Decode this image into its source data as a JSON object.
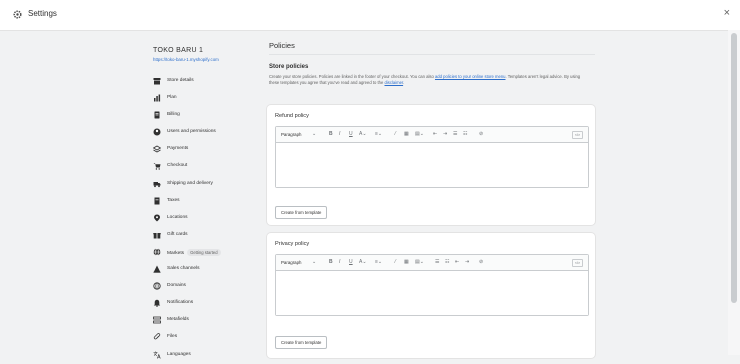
{
  "window": {
    "title": "Settings",
    "close_icon": "close-icon",
    "gear_icon": "gear-icon"
  },
  "sidebar": {
    "store_name": "TOKO BARU 1",
    "store_url": "https://toko-baru-1.myshopify.com",
    "items": [
      {
        "label": "Store details",
        "icon": "store-icon"
      },
      {
        "label": "Plan",
        "icon": "plan-icon"
      },
      {
        "label": "Billing",
        "icon": "billing-icon"
      },
      {
        "label": "Users and permissions",
        "icon": "users-icon"
      },
      {
        "label": "Payments",
        "icon": "payments-icon"
      },
      {
        "label": "Checkout",
        "icon": "checkout-icon"
      },
      {
        "label": "Shipping and delivery",
        "icon": "truck-icon"
      },
      {
        "label": "Taxes",
        "icon": "taxes-icon"
      },
      {
        "label": "Locations",
        "icon": "location-icon"
      },
      {
        "label": "Gift cards",
        "icon": "gift-icon"
      },
      {
        "label": "Markets",
        "icon": "globe-icon",
        "badge": "Getting started"
      },
      {
        "label": "Sales channels",
        "icon": "channels-icon"
      },
      {
        "label": "Domains",
        "icon": "domain-icon"
      },
      {
        "label": "Notifications",
        "icon": "bell-icon"
      },
      {
        "label": "Metafields",
        "icon": "metafields-icon"
      },
      {
        "label": "Files",
        "icon": "paperclip-icon"
      },
      {
        "label": "Languages",
        "icon": "language-icon"
      }
    ]
  },
  "main": {
    "page_title": "Policies",
    "section_title": "Store policies",
    "section_desc_1": "Create your store policies. Policies are linked in the footer of your checkout. You can also ",
    "section_desc_link_1": "add policies to your online store menu",
    "section_desc_2": ". Templates aren’t legal advice. By using these templates you agree that you’ve read and agreed to the ",
    "section_desc_link_2": "disclaimer",
    "section_desc_3": ".",
    "cards": [
      {
        "title": "Refund policy",
        "button": "Create from template"
      },
      {
        "title": "Privacy policy",
        "button": "Create from template"
      }
    ],
    "toolbar": {
      "format": "Paragraph",
      "html": "</>"
    }
  }
}
